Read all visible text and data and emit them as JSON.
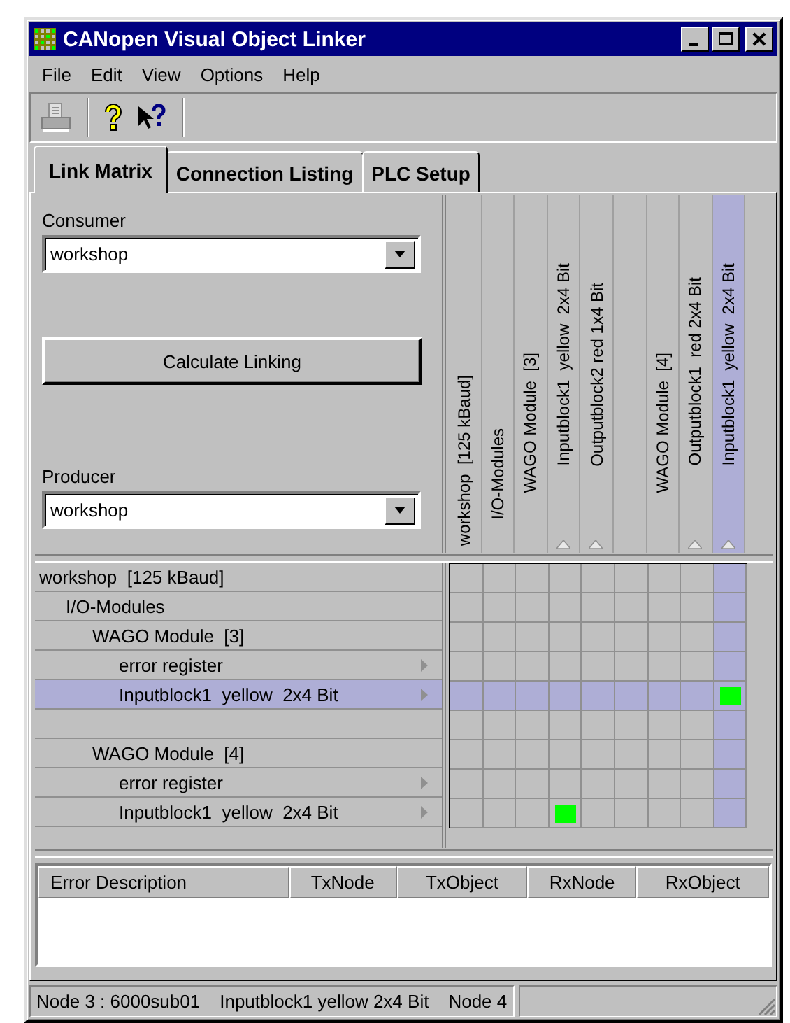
{
  "window": {
    "title": "CANopen Visual Object Linker"
  },
  "menu": [
    "File",
    "Edit",
    "View",
    "Options",
    "Help"
  ],
  "tabs": [
    {
      "label": "Link Matrix",
      "selected": true
    },
    {
      "label": "Connection Listing",
      "selected": false
    },
    {
      "label": "PLC Setup",
      "selected": false
    }
  ],
  "consumer": {
    "label": "Consumer",
    "value": "workshop"
  },
  "calculate_button": "Calculate Linking",
  "producer": {
    "label": "Producer",
    "value": "workshop"
  },
  "matrix": {
    "columns": [
      {
        "label": "workshop  [125 kBaud]",
        "kind": "node",
        "selected": false,
        "children": [
          {
            "label": "I/O-Modules",
            "kind": "node",
            "selected": false,
            "children": [
              {
                "label": "WAGO Module  [3]",
                "kind": "node",
                "selected": false,
                "children": [
                  {
                    "label": "Inputblock1  yellow  2x4 Bit",
                    "kind": "object",
                    "selected": false
                  },
                  {
                    "label": "Outputblock2 red 1x4 Bit",
                    "kind": "object",
                    "selected": false
                  },
                  {
                    "kind": "spacer",
                    "selected": false
                  }
                ]
              },
              {
                "label": "WAGO Module  [4]",
                "kind": "node",
                "selected": false,
                "children": [
                  {
                    "label": "Outputblock1  red 2x4 Bit",
                    "kind": "object",
                    "selected": false
                  },
                  {
                    "label": "Inputblock1  yellow  2x4 Bit",
                    "kind": "object",
                    "selected": true
                  }
                ]
              }
            ]
          }
        ]
      }
    ],
    "rows": [
      {
        "label": "workshop  [125 kBaud]",
        "kind": "node",
        "selected": false,
        "links": [
          false,
          false,
          false,
          false,
          false,
          false,
          false,
          false,
          false
        ],
        "children": [
          {
            "label": "I/O-Modules",
            "kind": "node",
            "selected": false,
            "links": [
              false,
              false,
              false,
              false,
              false,
              false,
              false,
              false,
              false
            ],
            "children": [
              {
                "label": "WAGO Module  [3]",
                "kind": "node",
                "selected": false,
                "links": [
                  false,
                  false,
                  false,
                  false,
                  false,
                  false,
                  false,
                  false,
                  false
                ],
                "children": [
                  {
                    "label": "error register",
                    "kind": "object",
                    "selected": false,
                    "links": [
                      false,
                      false,
                      false,
                      false,
                      false,
                      false,
                      false,
                      false,
                      false
                    ]
                  },
                  {
                    "label": "Inputblock1  yellow  2x4 Bit",
                    "kind": "object",
                    "selected": true,
                    "links": [
                      false,
                      false,
                      false,
                      false,
                      false,
                      false,
                      false,
                      false,
                      true
                    ]
                  },
                  {
                    "kind": "spacer",
                    "selected": false,
                    "links": [
                      false,
                      false,
                      false,
                      false,
                      false,
                      false,
                      false,
                      false,
                      false
                    ]
                  }
                ]
              },
              {
                "label": "WAGO Module  [4]",
                "kind": "node",
                "selected": false,
                "links": [
                  false,
                  false,
                  false,
                  false,
                  false,
                  false,
                  false,
                  false,
                  false
                ],
                "children": [
                  {
                    "label": "error register",
                    "kind": "object",
                    "selected": false,
                    "links": [
                      false,
                      false,
                      false,
                      false,
                      false,
                      false,
                      false,
                      false,
                      false
                    ]
                  },
                  {
                    "label": "Inputblock1  yellow  2x4 Bit",
                    "kind": "object",
                    "selected": false,
                    "links": [
                      false,
                      false,
                      false,
                      true,
                      false,
                      false,
                      false,
                      false,
                      false
                    ]
                  }
                ]
              }
            ]
          }
        ]
      }
    ]
  },
  "error_list": {
    "columns": [
      "Error Description",
      "TxNode",
      "TxObject",
      "RxNode",
      "RxObject"
    ]
  },
  "status_bar": {
    "texts": [
      "Node 3 : 6000sub01",
      "Inputblock1 yellow 2x4 Bit",
      "Node 4"
    ]
  }
}
